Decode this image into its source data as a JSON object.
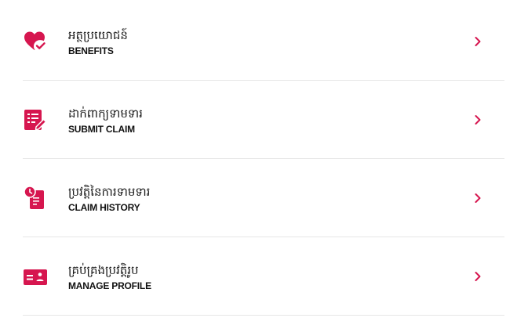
{
  "theme": {
    "accent": "#d6164f",
    "divider": "#e6e6e6",
    "text": "#111111"
  },
  "menu": {
    "items": [
      {
        "label_km": "អត្ថប្រយោជន៍",
        "label_en": "BENEFITS",
        "icon": "heart-check-icon"
      },
      {
        "label_km": "ដាក់ពាក្យទាមទារ",
        "label_en": "SUBMIT CLAIM",
        "icon": "document-edit-icon"
      },
      {
        "label_km": "ប្រវត្តិនៃការទាមទារ",
        "label_en": "CLAIM HISTORY",
        "icon": "clock-document-icon"
      },
      {
        "label_km": "គ្រប់គ្រងប្រវត្តិរូប",
        "label_en": "MANAGE PROFILE",
        "icon": "id-card-icon"
      }
    ]
  }
}
